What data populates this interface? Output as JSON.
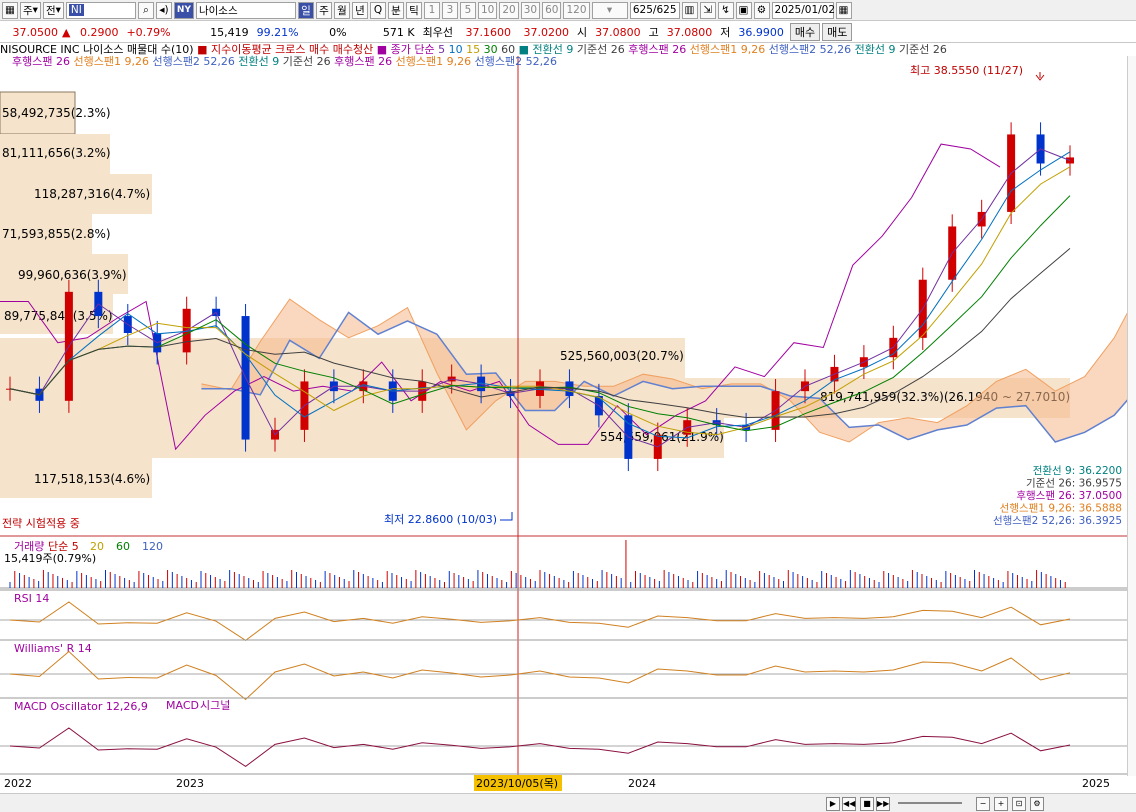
{
  "toolbar": {
    "period_select": "주",
    "period_select2": "전",
    "market_code": "NY",
    "code_input": "NI",
    "name_input": "나이소스",
    "periods": [
      "일",
      "주",
      "월",
      "년",
      "Q",
      "분",
      "틱"
    ],
    "minutes": [
      "1",
      "3",
      "5",
      "10",
      "20",
      "30",
      "60",
      "120"
    ],
    "count": "625",
    "count_total": "/625",
    "date": "2025/01/02"
  },
  "quote": {
    "price": "37.0500",
    "arrow": "▲",
    "change": "0.2900",
    "change_pct": "+0.79%",
    "volume": "15,419",
    "vol_ratio": "99.21%",
    "vol_pct": "0%",
    "amount": "571 K",
    "best_label": "최우선",
    "best_ask": "37.1600",
    "best_bid": "37.0200",
    "open_label": "시",
    "open": "37.0800",
    "high_label": "고",
    "high": "37.0800",
    "low_label": "저",
    "low": "36.9900",
    "buy_label": "매수",
    "sell_label": "매도"
  },
  "legend": {
    "line1": [
      {
        "text": "NISOURCE INC  나이소스 매물대 수(10)",
        "color": "#000000"
      },
      {
        "text": "■ 지수이동평균 크로스 매수  매수청산",
        "color": "#c00000"
      },
      {
        "text": "■ 종가 단순",
        "color": "#a000a0"
      },
      {
        "text": "5",
        "color": "#7030a0"
      },
      {
        "text": "10",
        "color": "#0070c0"
      },
      {
        "text": "15",
        "color": "#c0a000"
      },
      {
        "text": "30",
        "color": "#008000"
      },
      {
        "text": "60",
        "color": "#404040"
      },
      {
        "text": "■ 전환선 9",
        "color": "#008080"
      },
      {
        "text": "기준선 26",
        "color": "#404040"
      },
      {
        "text": "후행스팬 26",
        "color": "#a000a0"
      },
      {
        "text": "선행스팬1 9,26",
        "color": "#e08020"
      },
      {
        "text": "선행스팬2 52,26",
        "color": "#4060c0"
      },
      {
        "text": "전환선 9",
        "color": "#008080"
      },
      {
        "text": "기준선 26",
        "color": "#404040"
      }
    ],
    "line2": [
      {
        "text": "후행스팬 26",
        "color": "#a000a0"
      },
      {
        "text": "선행스팬1 9,26",
        "color": "#e08020"
      },
      {
        "text": "선행스팬2 52,26",
        "color": "#4060c0"
      },
      {
        "text": "전환선 9",
        "color": "#008080"
      },
      {
        "text": "기준선 26",
        "color": "#404040"
      },
      {
        "text": "후행스팬 26",
        "color": "#a000a0"
      },
      {
        "text": "선행스팬1 9,26",
        "color": "#e08020"
      },
      {
        "text": "선행스팬2 52,26",
        "color": "#4060c0"
      }
    ]
  },
  "chart_data": {
    "type": "line",
    "title": "NISOURCE INC  나이소스",
    "x_labels": [
      "2022",
      "2023",
      "2023/10/05(목)",
      "2024",
      "2025"
    ],
    "price_range": [
      20,
      40
    ],
    "high_annotation": "최고 38.5550 (11/27)",
    "low_annotation": "최저 22.8600 (10/03)",
    "strategy_label": "전략 시험적용 중",
    "close_series": [
      {
        "date": "2022-01",
        "close": 27.5
      },
      {
        "date": "2022-02",
        "close": 27.0
      },
      {
        "date": "2022-03",
        "close": 31.5
      },
      {
        "date": "2022-04",
        "close": 30.5
      },
      {
        "date": "2022-05",
        "close": 29.8
      },
      {
        "date": "2022-06",
        "close": 29.0
      },
      {
        "date": "2022-07",
        "close": 30.8
      },
      {
        "date": "2022-08",
        "close": 30.5
      },
      {
        "date": "2022-09",
        "close": 25.4
      },
      {
        "date": "2022-10",
        "close": 25.8
      },
      {
        "date": "2022-11",
        "close": 27.8
      },
      {
        "date": "2022-12",
        "close": 27.4
      },
      {
        "date": "2023-01",
        "close": 27.8
      },
      {
        "date": "2023-02",
        "close": 27.0
      },
      {
        "date": "2023-03",
        "close": 27.8
      },
      {
        "date": "2023-04",
        "close": 28.0
      },
      {
        "date": "2023-05",
        "close": 27.4
      },
      {
        "date": "2023-06",
        "close": 27.2
      },
      {
        "date": "2023-07",
        "close": 27.8
      },
      {
        "date": "2023-08",
        "close": 27.2
      },
      {
        "date": "2023-09",
        "close": 26.4
      },
      {
        "date": "2023-10",
        "close": 24.6
      },
      {
        "date": "2023-11",
        "close": 25.6
      },
      {
        "date": "2023-12",
        "close": 26.2
      },
      {
        "date": "2024-01",
        "close": 26.0
      },
      {
        "date": "2024-02",
        "close": 25.8
      },
      {
        "date": "2024-03",
        "close": 27.4
      },
      {
        "date": "2024-04",
        "close": 27.8
      },
      {
        "date": "2024-05",
        "close": 28.4
      },
      {
        "date": "2024-06",
        "close": 28.8
      },
      {
        "date": "2024-07",
        "close": 29.6
      },
      {
        "date": "2024-08",
        "close": 32.0
      },
      {
        "date": "2024-09",
        "close": 34.2
      },
      {
        "date": "2024-10",
        "close": 34.8
      },
      {
        "date": "2024-11",
        "close": 38.0
      },
      {
        "date": "2024-12",
        "close": 36.8
      },
      {
        "date": "2025-01",
        "close": 37.05
      }
    ],
    "volume_profile": [
      {
        "label": "58,492,735(2.3%)"
      },
      {
        "label": "81,111,656(3.2%)"
      },
      {
        "label": "118,287,316(4.7%)"
      },
      {
        "label": "71,593,855(2.8%)"
      },
      {
        "label": "99,960,636(3.9%)"
      },
      {
        "label": "89,775,841(3.5%)"
      },
      {
        "label": "525,560,003(20.7%)"
      },
      {
        "label": "819,741,959(32.3%)(26.1940 ~ 27.7010)"
      },
      {
        "label": "554,559,061(21.9%)"
      },
      {
        "label": "117,518,153(4.6%)"
      }
    ],
    "ichimoku_values": [
      {
        "label": "전환선 9: 36.2200",
        "color": "#008080"
      },
      {
        "label": "기준선 26: 36.9575",
        "color": "#404040"
      },
      {
        "label": "후행스팬 26: 37.0500",
        "color": "#a000a0"
      },
      {
        "label": "선행스팬1 9,26: 36.5888",
        "color": "#e08020"
      },
      {
        "label": "선행스팬2 52,26: 36.3925",
        "color": "#4060c0"
      }
    ],
    "volume_panel": {
      "legend": [
        "거래량",
        "단순 5",
        "20",
        "60",
        "120"
      ],
      "legend_colors": [
        "#a000a0",
        "#c00000",
        "#c0a000",
        "#008000",
        "#4060c0"
      ],
      "value_label": "15,419주(0.79%)"
    },
    "rsi_panel": {
      "label": "RSI 14"
    },
    "williams_panel": {
      "label": "Williams' R 14"
    },
    "macd_panel": {
      "label": "MACD Oscillator 12,26,9",
      "macd": "MACD",
      "signal": "시그널"
    }
  },
  "colors": {
    "profile_box": "#f5e3cc",
    "crosshair": "#d02020",
    "up": "#d00000",
    "down": "#0033cc",
    "cloud_up": "#f0a060",
    "cloud_down": "#6080d0",
    "panel_line": "#d08020"
  }
}
